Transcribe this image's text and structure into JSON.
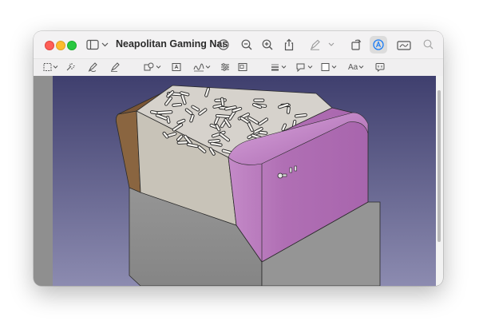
{
  "window": {
    "title": "Neapolitan Gaming Nas"
  },
  "toolbar": {
    "font_button_label": "Aa"
  },
  "colors": {
    "viewport_top": "#3f3f6e",
    "viewport_bottom": "#8c8bb0",
    "pink_panel": "#b06fb4",
    "brown_panel": "#8a6540",
    "cream_panel": "#c8c3b8",
    "grey_base": "#8d8d8d",
    "accent_blue": "#1a7cf5"
  }
}
